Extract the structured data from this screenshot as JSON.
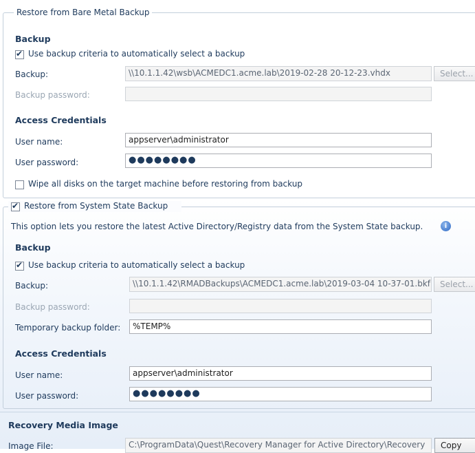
{
  "bare_metal": {
    "legend": "Restore from Bare Metal Backup",
    "backup_heading": "Backup",
    "use_criteria_label": "Use backup criteria to automatically select a backup",
    "use_criteria_checked": true,
    "backup_label": "Backup:",
    "backup_value": "\\\\10.1.1.42\\wsb\\ACMEDC1.acme.lab\\2019-02-28 20-12-23.vhdx",
    "select_button": "Select...",
    "backup_password_label": "Backup password:",
    "backup_password_value": "",
    "credentials_heading": "Access Credentials",
    "user_name_label": "User name:",
    "user_name_value": "appserver\\administrator",
    "user_password_label": "User password:",
    "user_password_value": "●●●●●●●●",
    "wipe_label": "Wipe all disks on the target machine before restoring from backup",
    "wipe_checked": false
  },
  "system_state": {
    "legend": "Restore from System State Backup",
    "legend_checked": true,
    "description": "This option lets you restore the latest Active Directory/Registry data from the System State backup.",
    "info_icon": "info-icon",
    "backup_heading": "Backup",
    "use_criteria_label": "Use backup criteria to automatically select a backup",
    "use_criteria_checked": true,
    "backup_label": "Backup:",
    "backup_value": "\\\\10.1.1.42\\RMADBackups\\ACMEDC1.acme.lab\\2019-03-04 10-37-01.bkf",
    "select_button": "Select...",
    "backup_password_label": "Backup password:",
    "backup_password_value": "",
    "temp_folder_label": "Temporary backup folder:",
    "temp_folder_value": "%TEMP%",
    "credentials_heading": "Access Credentials",
    "user_name_label": "User name:",
    "user_name_value": "appserver\\administrator",
    "user_password_label": "User password:",
    "user_password_value": "●●●●●●●●"
  },
  "recovery_media": {
    "heading": "Recovery Media Image",
    "image_file_label": "Image File:",
    "image_file_value": "C:\\ProgramData\\Quest\\Recovery Manager for Active Directory\\Recovery",
    "copy_button": "Copy"
  }
}
